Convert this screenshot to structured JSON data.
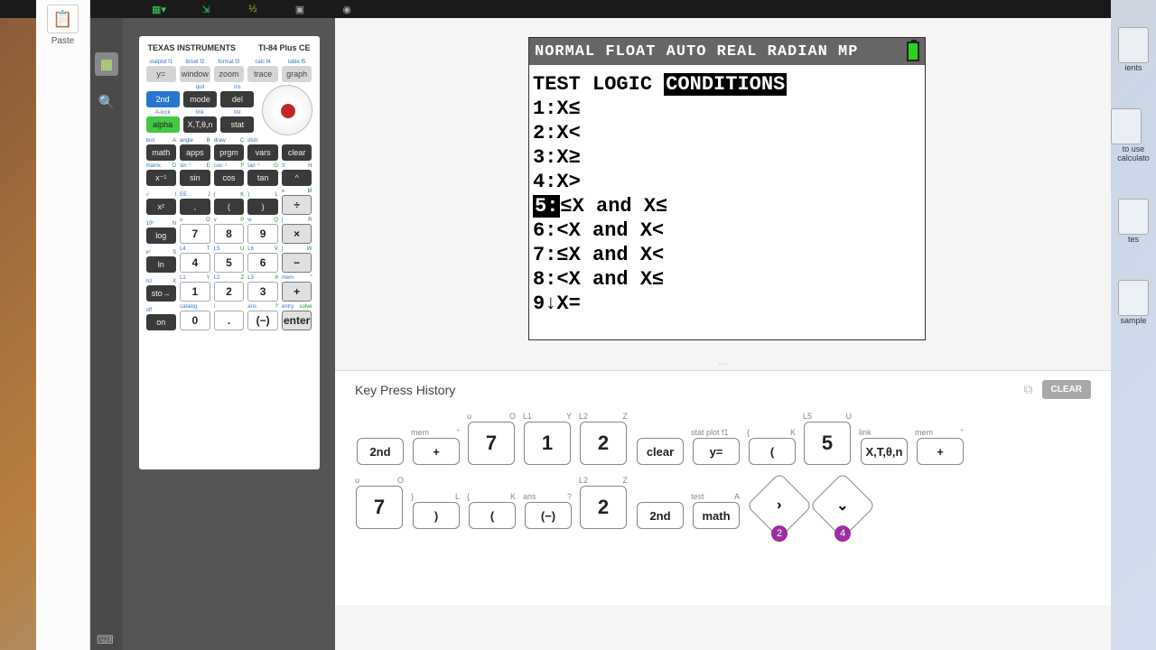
{
  "topbar": {
    "icons": [
      "table",
      "dollar",
      "dollar2",
      "windows",
      "camera"
    ]
  },
  "left_sidebar": {
    "paste_label": "Paste"
  },
  "side_strip": {
    "calc_icon": "calc",
    "search_icon": "search"
  },
  "calculator": {
    "brand": "TEXAS INSTRUMENTS",
    "model": "TI-84 Plus CE",
    "row1_sec": [
      "statplot f1",
      "tblset f2",
      "format f3",
      "calc f4",
      "table f5"
    ],
    "row1": [
      "y=",
      "window",
      "zoom",
      "trace",
      "graph"
    ],
    "row2_sec": [
      "",
      "quit",
      "ins"
    ],
    "row2": [
      "2nd",
      "mode",
      "del"
    ],
    "row3_sec": [
      "A-lock",
      "link",
      "list"
    ],
    "row3": [
      "alpha",
      "X,T,θ,n",
      "stat"
    ],
    "row4_sec": [
      [
        "test",
        "A"
      ],
      [
        "angle",
        "B"
      ],
      [
        "draw",
        "C"
      ],
      [
        "distr",
        ""
      ]
    ],
    "row4": [
      "math",
      "apps",
      "prgm",
      "vars",
      "clear"
    ],
    "row5_sec": [
      [
        "matrix",
        "D"
      ],
      [
        "sin⁻¹",
        "E"
      ],
      [
        "cos⁻¹",
        "F"
      ],
      [
        "tan⁻¹",
        "G"
      ],
      [
        "π",
        "H"
      ]
    ],
    "row5": [
      "x⁻¹",
      "sin",
      "cos",
      "tan",
      "^"
    ],
    "row6_sec": [
      [
        "√",
        "I"
      ],
      [
        "EE",
        "J"
      ],
      [
        "{",
        "K"
      ],
      [
        "}",
        "L"
      ],
      [
        "e",
        "M"
      ]
    ],
    "row6": [
      "x²",
      ",",
      "(",
      ")",
      "÷"
    ],
    "row7_sec": [
      [
        "10ˣ",
        "N"
      ],
      [
        "u",
        "O"
      ],
      [
        "v",
        "P"
      ],
      [
        "w",
        "Q"
      ],
      [
        "[",
        "R"
      ]
    ],
    "row7": [
      "log",
      "7",
      "8",
      "9",
      "×"
    ],
    "row8_sec": [
      [
        "eˣ",
        "S"
      ],
      [
        "L4",
        "T"
      ],
      [
        "L5",
        "U"
      ],
      [
        "L6",
        "V"
      ],
      [
        "]",
        "W"
      ]
    ],
    "row8": [
      "ln",
      "4",
      "5",
      "6",
      "−"
    ],
    "row9_sec": [
      [
        "rcl",
        "X"
      ],
      [
        "L1",
        "Y"
      ],
      [
        "L2",
        "Z"
      ],
      [
        "L3",
        "θ"
      ],
      [
        "mem",
        "\""
      ]
    ],
    "row9": [
      "sto→",
      "1",
      "2",
      "3",
      "+"
    ],
    "row10_sec": [
      [
        "off",
        ""
      ],
      [
        "catalog",
        ""
      ],
      [
        "i",
        ""
      ],
      [
        "ans",
        "?"
      ],
      [
        "entry",
        "solve"
      ]
    ],
    "row10": [
      "on",
      "0",
      ".",
      "(−)",
      "enter"
    ]
  },
  "screen": {
    "status": "NORMAL FLOAT AUTO REAL RADIAN MP",
    "title_plain": "TEST LOGIC ",
    "title_highlight": "CONDITIONS",
    "lines": [
      {
        "num": "1:",
        "text": "X≤",
        "sel": false
      },
      {
        "num": "2:",
        "text": "X<",
        "sel": false
      },
      {
        "num": "3:",
        "text": "X≥",
        "sel": false
      },
      {
        "num": "4:",
        "text": "X>",
        "sel": false
      },
      {
        "num": "5:",
        "text": "≤X  and  X≤",
        "sel": true
      },
      {
        "num": "6:",
        "text": "<X  and  X<",
        "sel": false
      },
      {
        "num": "7:",
        "text": "≤X  and  X<",
        "sel": false
      },
      {
        "num": "8:",
        "text": "<X  and  X≤",
        "sel": false
      },
      {
        "num": "9↓",
        "text": "X=",
        "sel": false
      }
    ]
  },
  "history": {
    "title": "Key Press History",
    "clear_label": "CLEAR",
    "keys": [
      {
        "l": "",
        "r": "",
        "label": "2nd",
        "h": "short"
      },
      {
        "l": "mem",
        "r": "\"",
        "label": "+",
        "h": "short"
      },
      {
        "l": "u",
        "r": "O",
        "label": "7",
        "h": "tall"
      },
      {
        "l": "L1",
        "r": "Y",
        "label": "1",
        "h": "tall"
      },
      {
        "l": "L2",
        "r": "Z",
        "label": "2",
        "h": "tall"
      },
      {
        "l": "",
        "r": "",
        "label": "clear",
        "h": "short"
      },
      {
        "l": "stat plot f1",
        "r": "",
        "label": "y=",
        "h": "short"
      },
      {
        "l": "{",
        "r": "K",
        "label": "(",
        "h": "short"
      },
      {
        "l": "L5",
        "r": "U",
        "label": "5",
        "h": "tall"
      },
      {
        "l": "link",
        "r": "",
        "label": "X,T,θ,n",
        "h": "short"
      },
      {
        "l": "mem",
        "r": "\"",
        "label": "+",
        "h": "short"
      }
    ],
    "keys2": [
      {
        "l": "u",
        "r": "O",
        "label": "7",
        "h": "tall"
      },
      {
        "l": "}",
        "r": "L",
        "label": ")",
        "h": "short"
      },
      {
        "l": "{",
        "r": "K",
        "label": "(",
        "h": "short"
      },
      {
        "l": "ans",
        "r": "?",
        "label": "(−)",
        "h": "short"
      },
      {
        "l": "L2",
        "r": "Z",
        "label": "2",
        "h": "tall"
      },
      {
        "l": "",
        "r": "",
        "label": "2nd",
        "h": "short"
      },
      {
        "l": "test",
        "r": "A",
        "label": "math",
        "h": "short"
      }
    ],
    "dpad_right": {
      "arrow": "›",
      "badge": "2"
    },
    "dpad_down": {
      "arrow": "⌄",
      "badge": "4"
    }
  },
  "right_edge": {
    "items": [
      "ients",
      "to use calculato",
      "tes",
      "sample"
    ]
  }
}
